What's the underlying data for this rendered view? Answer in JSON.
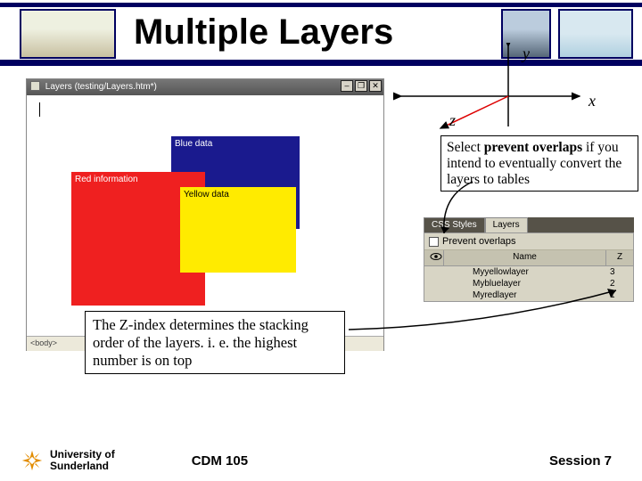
{
  "title": "Multiple Layers",
  "axes": {
    "x": "x",
    "y": "y",
    "z": "z"
  },
  "window": {
    "title": "Layers (testing/Layers.htm*)",
    "status": "<body>",
    "layers": {
      "blue": "Blue data",
      "red": "Red information",
      "yellow": "Yellow data"
    }
  },
  "tip1": {
    "lead": "Select ",
    "bold": "prevent overlaps",
    "rest": " if you intend to eventually convert the layers to tables"
  },
  "panel": {
    "tab_css": "CSS Styles",
    "tab_layers": "Layers",
    "prevent_label": "Prevent overlaps",
    "col_name": "Name",
    "col_z": "Z",
    "rows": [
      {
        "name": "Myyellowlayer",
        "z": "3"
      },
      {
        "name": "Mybluelayer",
        "z": "2"
      },
      {
        "name": "Myredlayer",
        "z": "1"
      }
    ]
  },
  "tip2": "The Z-index determines the stacking order of the layers. i. e. the highest number is on top",
  "footer": {
    "uni1": "University of",
    "uni2": "Sunderland",
    "course": "CDM 105",
    "session": "Session 7"
  }
}
